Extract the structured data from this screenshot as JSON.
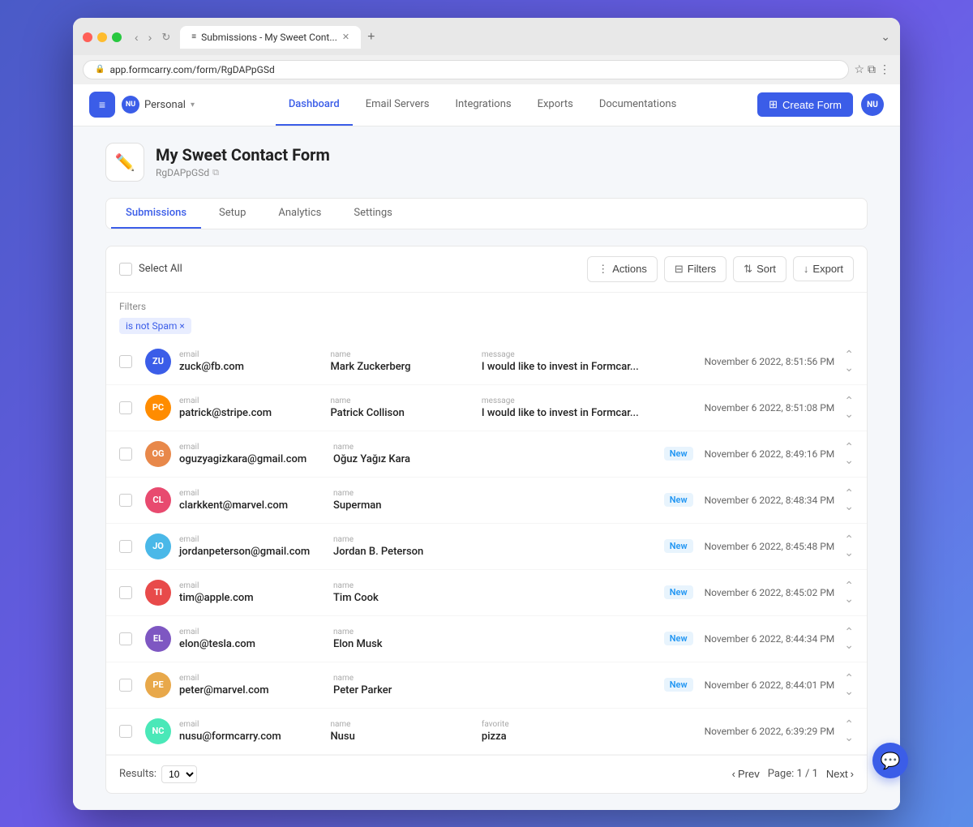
{
  "browser": {
    "tab_title": "Submissions - My Sweet Cont...",
    "url": "app.formcarry.com/form/RgDAPpGSd",
    "new_tab_icon": "+",
    "more_icon": "⋮"
  },
  "nav": {
    "logo_text": "≡",
    "workspace_initials": "NU",
    "workspace_name": "Personal",
    "links": [
      {
        "label": "Dashboard",
        "active": true
      },
      {
        "label": "Email Servers",
        "active": false
      },
      {
        "label": "Integrations",
        "active": false
      },
      {
        "label": "Exports",
        "active": false
      },
      {
        "label": "Documentations",
        "active": false
      }
    ],
    "create_form_label": "Create Form",
    "user_initials": "NU"
  },
  "form": {
    "icon_emoji": "✏️",
    "title": "My Sweet Contact Form",
    "id": "RgDAPpGSd",
    "copy_icon": "⧉"
  },
  "form_tabs": [
    {
      "label": "Submissions",
      "active": true
    },
    {
      "label": "Setup",
      "active": false
    },
    {
      "label": "Analytics",
      "active": false
    },
    {
      "label": "Settings",
      "active": false
    }
  ],
  "toolbar": {
    "select_all_label": "Select All",
    "actions_label": "Actions",
    "filters_label": "Filters",
    "sort_label": "Sort",
    "export_label": "Export"
  },
  "filters": {
    "label": "Filters",
    "active_filters": [
      {
        "text": "is not Spam ×"
      }
    ]
  },
  "submissions": [
    {
      "initials": "ZU",
      "avatar_color": "#3b5de8",
      "has_photo": false,
      "email_label": "email",
      "email": "zuck@fb.com",
      "name_label": "name",
      "name": "Mark Zuckerberg",
      "message_label": "message",
      "message": "I would like to invest in Formcar...",
      "is_new": false,
      "timestamp": "November 6 2022, 8:51:56 PM"
    },
    {
      "initials": "PC",
      "avatar_color": "#555",
      "has_photo": true,
      "photo_bg": "#ff8c00",
      "email_label": "email",
      "email": "patrick@stripe.com",
      "name_label": "name",
      "name": "Patrick Collison",
      "message_label": "message",
      "message": "I would like to invest in Formcar...",
      "is_new": false,
      "timestamp": "November 6 2022, 8:51:08 PM"
    },
    {
      "initials": "OG",
      "avatar_color": "#e8884a",
      "has_photo": false,
      "email_label": "email",
      "email": "oguzyagizkara@gmail.com",
      "name_label": "name",
      "name": "Oğuz Yağız Kara",
      "message_label": "",
      "message": "",
      "is_new": true,
      "timestamp": "November 6 2022, 8:49:16 PM"
    },
    {
      "initials": "CL",
      "avatar_color": "#e84a6f",
      "has_photo": false,
      "email_label": "email",
      "email": "clarkkent@marvel.com",
      "name_label": "name",
      "name": "Superman",
      "message_label": "",
      "message": "",
      "is_new": true,
      "timestamp": "November 6 2022, 8:48:34 PM"
    },
    {
      "initials": "JO",
      "avatar_color": "#4ab8e8",
      "has_photo": false,
      "email_label": "email",
      "email": "jordanpeterson@gmail.com",
      "name_label": "name",
      "name": "Jordan B. Peterson",
      "message_label": "",
      "message": "",
      "is_new": true,
      "timestamp": "November 6 2022, 8:45:48 PM"
    },
    {
      "initials": "TI",
      "avatar_color": "#e84a4a",
      "has_photo": false,
      "email_label": "email",
      "email": "tim@apple.com",
      "name_label": "name",
      "name": "Tim Cook",
      "message_label": "",
      "message": "",
      "is_new": true,
      "timestamp": "November 6 2022, 8:45:02 PM"
    },
    {
      "initials": "EL",
      "avatar_color": "#7e57c2",
      "has_photo": false,
      "email_label": "email",
      "email": "elon@tesla.com",
      "name_label": "name",
      "name": "Elon Musk",
      "message_label": "",
      "message": "",
      "is_new": true,
      "timestamp": "November 6 2022, 8:44:34 PM"
    },
    {
      "initials": "PE",
      "avatar_color": "#e8a84a",
      "has_photo": false,
      "email_label": "email",
      "email": "peter@marvel.com",
      "name_label": "name",
      "name": "Peter Parker",
      "message_label": "",
      "message": "",
      "is_new": true,
      "timestamp": "November 6 2022, 8:44:01 PM"
    },
    {
      "initials": "NC",
      "avatar_color": "#4ae8b8",
      "has_photo": false,
      "email_label": "email",
      "email": "nusu@formcarry.com",
      "name_label": "name",
      "name": "Nusu",
      "message_label": "favorite",
      "message": "pizza",
      "is_new": false,
      "timestamp": "November 6 2022, 6:39:29 PM"
    }
  ],
  "pagination": {
    "results_label": "Results:",
    "results_count": "10",
    "prev_label": "Prev",
    "page_label": "Page: 1 / 1",
    "next_label": "Next"
  }
}
